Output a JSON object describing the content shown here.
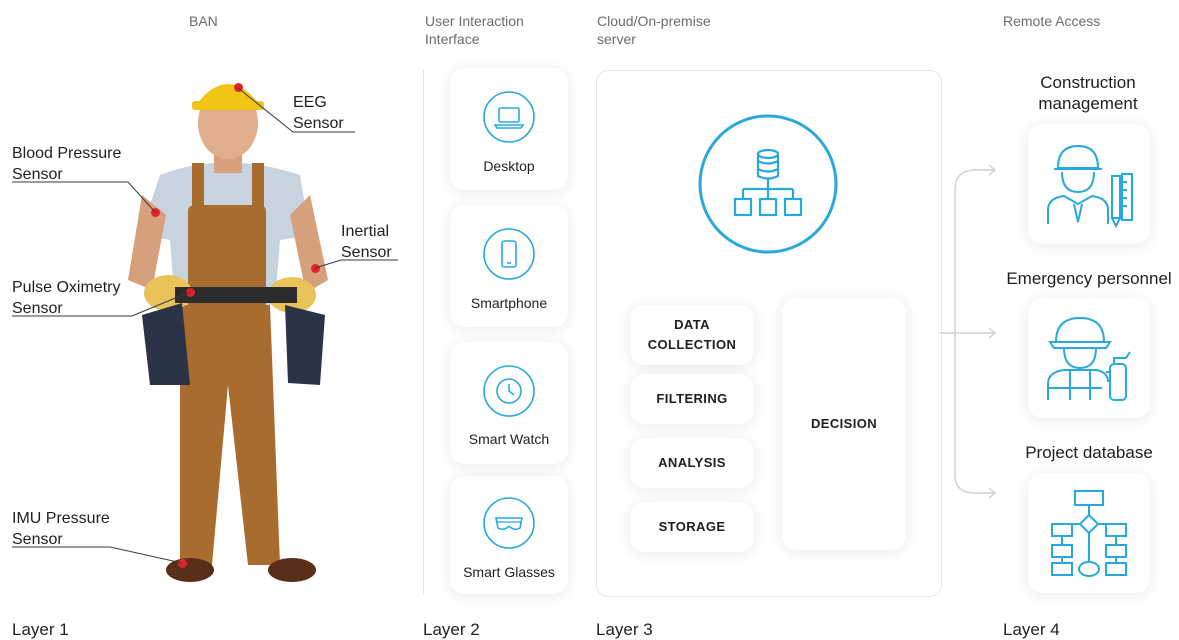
{
  "columns": {
    "ban": "BAN",
    "ui_line1": "User Interaction",
    "ui_line2": "Interface",
    "server_line1": "Cloud/On-premise",
    "server_line2": "server",
    "remote": "Remote Access"
  },
  "layers": {
    "l1": "Layer 1",
    "l2": "Layer 2",
    "l3": "Layer 3",
    "l4": "Layer 4"
  },
  "sensors": {
    "eeg_1": "EEG",
    "eeg_2": "Sensor",
    "bp_1": "Blood Pressure",
    "bp_2": "Sensor",
    "inertial_1": "Inertial",
    "inertial_2": "Sensor",
    "pulse_1": "Pulse Oximetry",
    "pulse_2": "Sensor",
    "imu_1": "IMU Pressure",
    "imu_2": "Sensor"
  },
  "devices": {
    "desktop": "Desktop",
    "smartphone": "Smartphone",
    "smartwatch": "Smart Watch",
    "glasses": "Smart  Glasses"
  },
  "server": {
    "data_collection_1": "DATA",
    "data_collection_2": "COLLECTION",
    "filtering": "FILTERING",
    "analysis": "ANALYSIS",
    "storage": "STORAGE",
    "decision": "DECISION"
  },
  "remote": {
    "construction_1": "Construction",
    "construction_2": "management",
    "emergency": "Emergency personnel",
    "database": "Project database"
  },
  "colors": {
    "accent": "#29a8de",
    "sensor_dot": "#e0232b"
  }
}
